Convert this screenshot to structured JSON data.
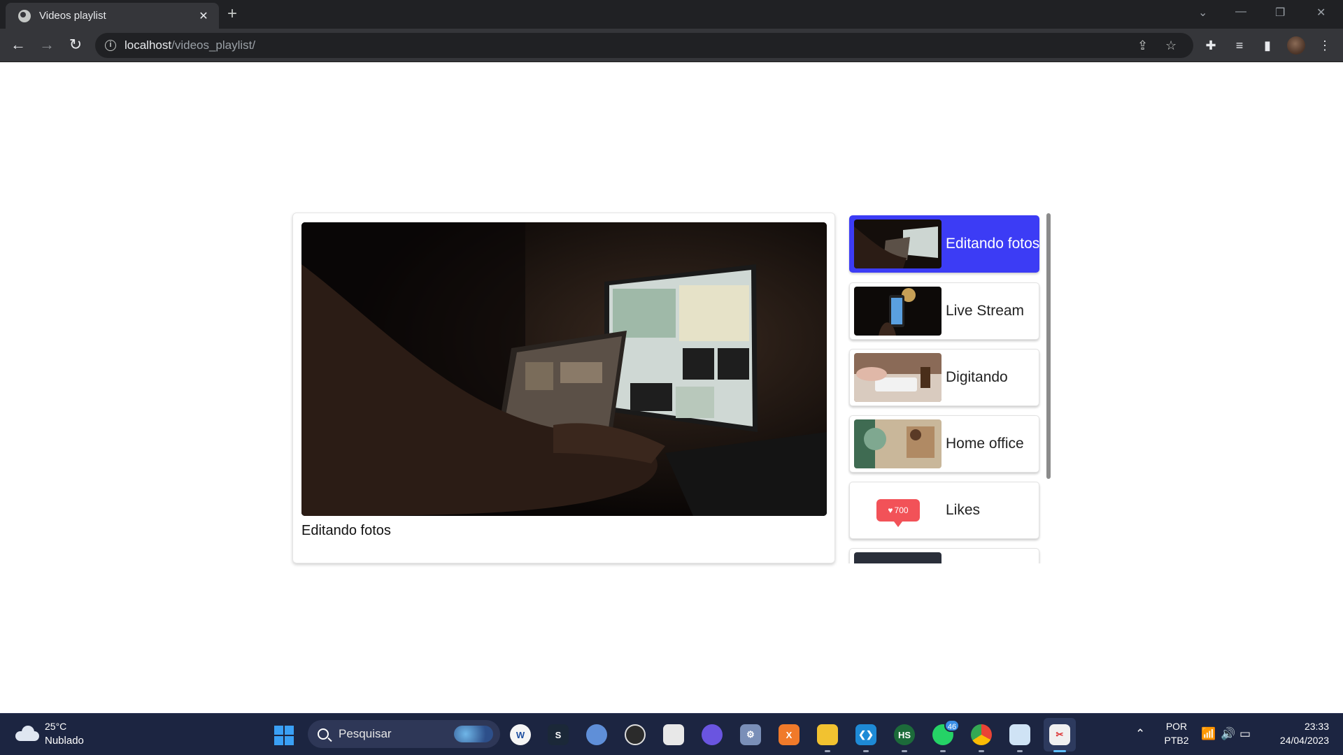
{
  "browser": {
    "tab_title": "Videos playlist",
    "tab_close": "✕",
    "new_tab": "+",
    "url_host": "localhost",
    "url_path": "/videos_playlist/"
  },
  "player": {
    "current_title": "Editando fotos"
  },
  "playlist": {
    "items": [
      {
        "label": "Editando fotos",
        "thumb": "editing-photos",
        "active": true
      },
      {
        "label": "Live Stream",
        "thumb": "live-stream",
        "active": false
      },
      {
        "label": "Digitando",
        "thumb": "typing",
        "active": false
      },
      {
        "label": "Home office",
        "thumb": "home-office",
        "active": false
      },
      {
        "label": "Likes",
        "thumb": "likes-badge",
        "active": false,
        "badge_count": "700"
      },
      {
        "label": "",
        "thumb": "dark",
        "active": false
      }
    ],
    "accent_color": "#3c3cf5"
  },
  "taskbar": {
    "weather_temp": "25°C",
    "weather_desc": "Nublado",
    "search_placeholder": "Pesquisar",
    "whatsapp_badge": "46",
    "lang_top": "POR",
    "lang_bottom": "PTB2",
    "time": "23:33",
    "date": "24/04/2023"
  }
}
